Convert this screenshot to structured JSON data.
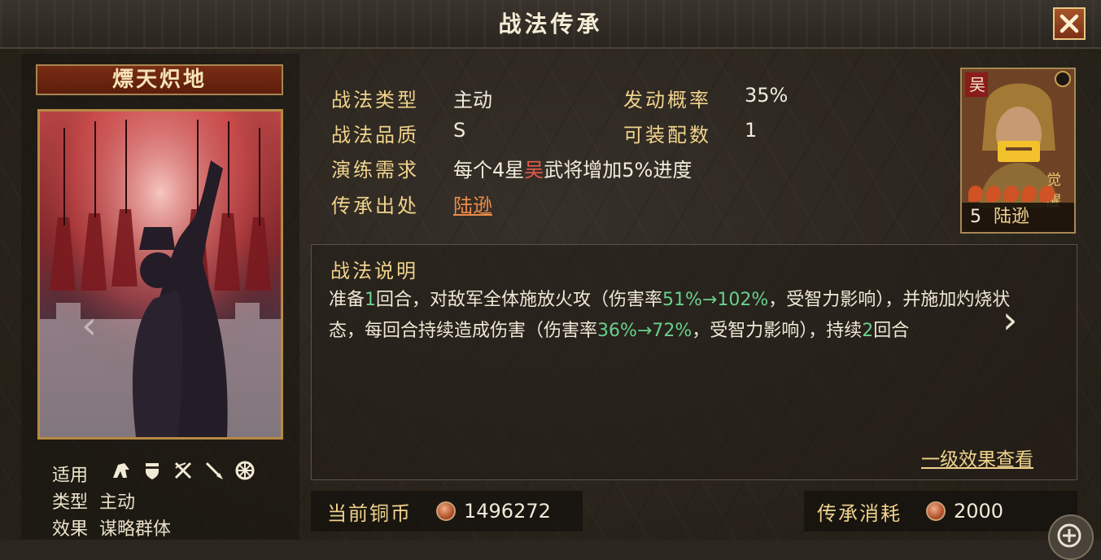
{
  "header": {
    "title": "战法传承",
    "close": "✕"
  },
  "skill": {
    "name": "熛天炽地",
    "meta": [
      {
        "label": "适用",
        "value": ""
      },
      {
        "label": "类型",
        "value": "主动"
      },
      {
        "label": "效果",
        "value": "谋略群体"
      }
    ],
    "unit_icons": [
      "cavalry-icon",
      "shield-icon",
      "crossbow-icon",
      "spear-icon",
      "wheel-icon"
    ]
  },
  "info": {
    "type_label": "战法类型",
    "type_value": "主动",
    "rate_label": "发动概率",
    "rate_value": "35%",
    "quality_label": "战法品质",
    "quality_value": "S",
    "equip_label": "可装配数",
    "equip_value": "1",
    "drill_label": "演练需求",
    "drill_value_pre": "每个4星",
    "drill_value_faction": "吴",
    "drill_value_post": "武将增加5%进度",
    "source_label": "传承出处",
    "source_value": "陆逊"
  },
  "general": {
    "faction": "吴",
    "level": "5",
    "name": "陆逊",
    "stars": 5,
    "awaken_badge": "觉醒"
  },
  "description": {
    "title": "战法说明",
    "segments": [
      {
        "t": "准备",
        "c": ""
      },
      {
        "t": "1",
        "c": "green"
      },
      {
        "t": "回合，对敌军全体施放火攻（伤害率",
        "c": ""
      },
      {
        "t": "51%→102%",
        "c": "green"
      },
      {
        "t": "，受智力影响），并施加灼烧状态，每回合持续造成伤害（伤害率",
        "c": ""
      },
      {
        "t": "36%→72%",
        "c": "green"
      },
      {
        "t": "，受智力影响），持续",
        "c": ""
      },
      {
        "t": "2",
        "c": "green"
      },
      {
        "t": "回合",
        "c": ""
      }
    ],
    "effect_link": "一级效果查看"
  },
  "bottom": {
    "coin_label": "当前铜币",
    "coin_value": "1496272",
    "cost_label": "传承消耗",
    "cost_value": "2000"
  },
  "colors": {
    "gold": "#f0d38c",
    "green": "#69d08c",
    "red": "#e65b4b",
    "orange": "#ee8c4a"
  }
}
